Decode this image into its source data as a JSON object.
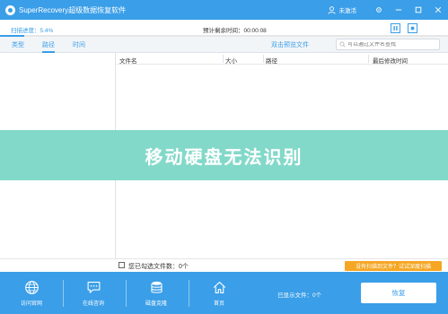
{
  "app": {
    "title": "SuperRecovery超级数据恢复软件",
    "user_label": "未激活"
  },
  "scan": {
    "progress_label": "扫描进度：5.4%",
    "progress_value": 0.054,
    "remaining_time": "预计剩余时间：00:00:08"
  },
  "tabs": [
    {
      "label": "类型",
      "active": false
    },
    {
      "label": "路径",
      "active": true
    },
    {
      "label": "时间",
      "active": false
    }
  ],
  "toolbar": {
    "preview_label": "双击预览文件",
    "search_placeholder": "可以通过文件名查找"
  },
  "table": {
    "columns": [
      "文件名",
      "大小",
      "路径",
      "最后修改时间"
    ]
  },
  "banner": {
    "text": "移动硬盘无法识别"
  },
  "status": {
    "selected_label": "您已勾选文件数：0个",
    "warning_label": "没有扫描到文件？试试深度扫描"
  },
  "bottom_nav": [
    {
      "label": "访问官网",
      "icon": "globe-icon"
    },
    {
      "label": "在线咨询",
      "icon": "chat-icon"
    },
    {
      "label": "磁盘克隆",
      "icon": "database-icon"
    },
    {
      "label": "首页",
      "icon": "home-icon"
    }
  ],
  "footer": {
    "displayed_count": "已显示文件：0个",
    "restore_label": "恢复"
  },
  "colors": {
    "primary": "#3a9ee8",
    "banner": "#78d6c4",
    "warning": "#f5a623"
  }
}
